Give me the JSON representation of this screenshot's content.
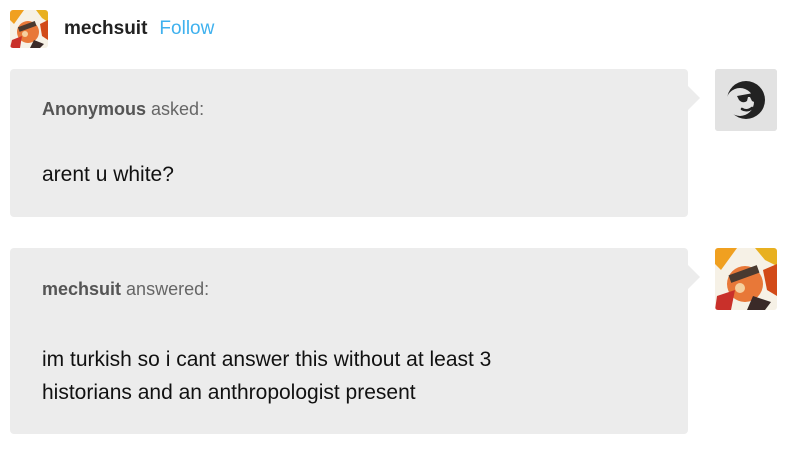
{
  "post": {
    "author": "mechsuit",
    "follow_label": "Follow"
  },
  "ask": {
    "asker": "Anonymous",
    "verb": "asked:",
    "question": "arent u white?"
  },
  "answer": {
    "answerer": "mechsuit",
    "verb": "answered:",
    "lines": [
      "im turkish so i cant answer this without at least 3",
      "historians and an anthropologist present"
    ]
  },
  "colors": {
    "follow": "#3fb1ee",
    "bubble": "#ececec",
    "username": "#222222"
  },
  "icons": {
    "anonymous_avatar": "sunglasses-face-icon",
    "user_avatar": "mechsuit-avatar"
  }
}
